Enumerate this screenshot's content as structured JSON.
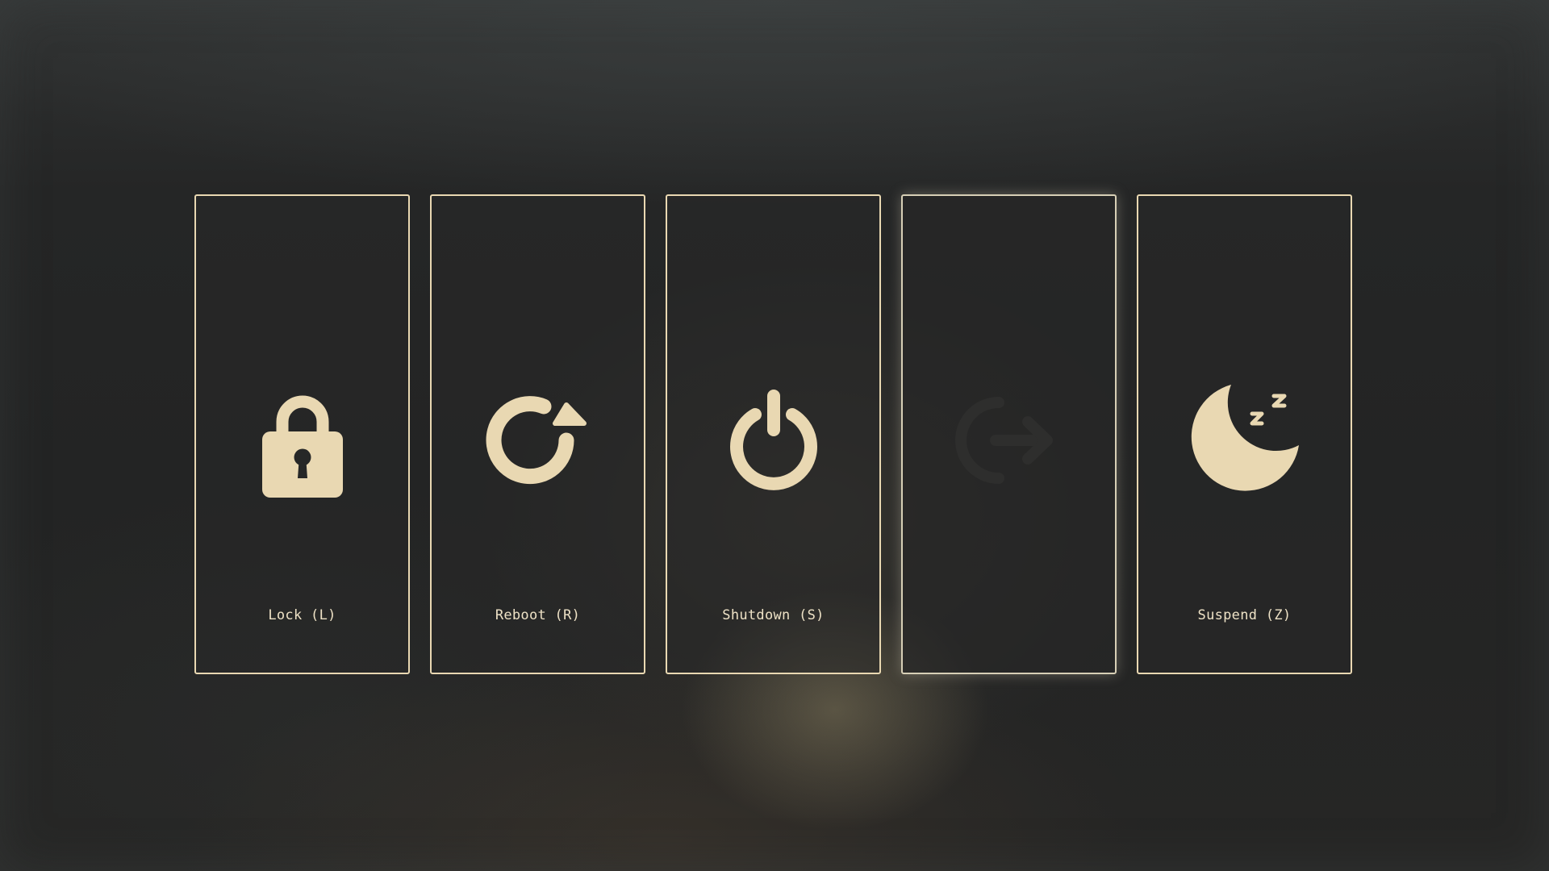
{
  "colors": {
    "accent": "#e9d8b2",
    "background": "#262727"
  },
  "actions": [
    {
      "id": "lock",
      "label": "Lock (L)",
      "icon": "lock-icon"
    },
    {
      "id": "reboot",
      "label": "Reboot (R)",
      "icon": "reboot-icon"
    },
    {
      "id": "shutdown",
      "label": "Shutdown (S)",
      "icon": "power-icon"
    },
    {
      "id": "logout",
      "label": "",
      "icon": "logout-icon"
    },
    {
      "id": "suspend",
      "label": "Suspend (Z)",
      "icon": "sleep-moon-icon"
    }
  ]
}
